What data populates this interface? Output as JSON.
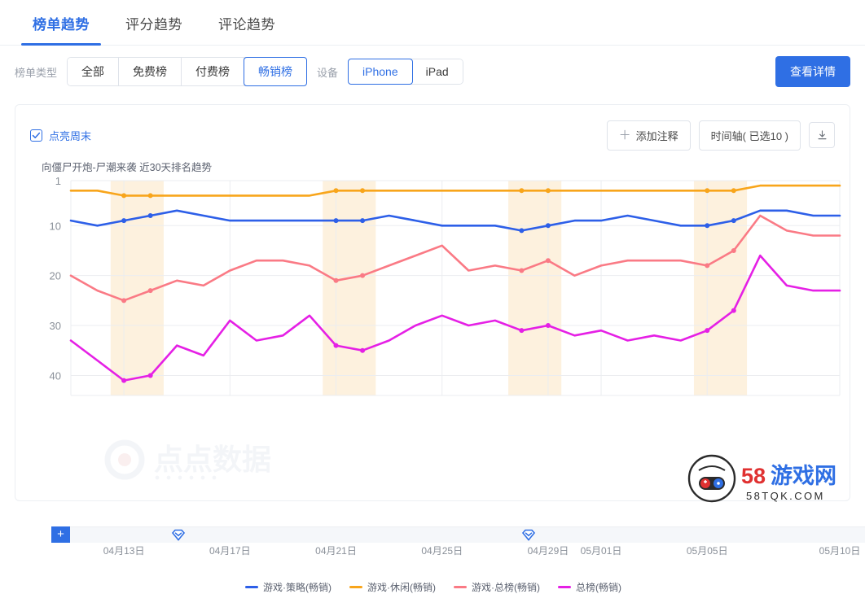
{
  "tabs": [
    {
      "label": "榜单趋势",
      "active": true
    },
    {
      "label": "评分趋势",
      "active": false
    },
    {
      "label": "评论趋势",
      "active": false
    }
  ],
  "filters": {
    "rank_type_label": "榜单类型",
    "rank_type_options": [
      "全部",
      "免费榜",
      "付费榜",
      "畅销榜"
    ],
    "rank_type_selected": "畅销榜",
    "device_label": "设备",
    "device_options": [
      "iPhone",
      "iPad"
    ],
    "device_selected": "iPhone",
    "detail_button": "查看详情"
  },
  "card": {
    "weekend_checkbox_label": "点亮周末",
    "weekend_checked": true,
    "add_note_button": "添加注释",
    "add_note_plus": "＋",
    "timeline_button": "时间轴( 已选10 )",
    "download_icon": "download-icon",
    "plus_marker": "+",
    "timeline_markers": [
      200,
      630
    ]
  },
  "watermark": {
    "center_text": "点点数据",
    "corner_brand": "58 游戏网",
    "corner_domain": "58TQK.COM"
  },
  "colors": {
    "accent": "#2f6fe4",
    "strategy": "#2d5fe8",
    "casual": "#f8a51b",
    "game_overall": "#fa7a85",
    "overall": "#e520e5",
    "weekend_band": "#fdf1de",
    "grid": "#ebedf0"
  },
  "chart_data": {
    "type": "line",
    "title": "向僵尸开炮-尸潮来袭 近30天排名趋势",
    "xlabel": "",
    "ylabel": "",
    "ylim": [
      1,
      44
    ],
    "y_inverted": true,
    "y_ticks": [
      1,
      10,
      20,
      30,
      40
    ],
    "grid": true,
    "legend_position": "bottom",
    "x": [
      "04月11日",
      "04月12日",
      "04月13日",
      "04月14日",
      "04月15日",
      "04月16日",
      "04月17日",
      "04月18日",
      "04月19日",
      "04月20日",
      "04月21日",
      "04月22日",
      "04月23日",
      "04月24日",
      "04月25日",
      "04月26日",
      "04月27日",
      "04月28日",
      "04月29日",
      "04月30日",
      "05月01日",
      "05月02日",
      "05月03日",
      "05月04日",
      "05月05日",
      "05月06日",
      "05月07日",
      "05月08日",
      "05月09日",
      "05月10日"
    ],
    "x_tick_labels": [
      "04月13日",
      "04月17日",
      "04月21日",
      "04月25日",
      "04月29日",
      "05月01日",
      "05月05日",
      "05月10日"
    ],
    "x_tick_indices": [
      2,
      6,
      10,
      14,
      18,
      20,
      24,
      29
    ],
    "weekend_bands": [
      [
        2,
        3
      ],
      [
        10,
        11
      ],
      [
        17,
        18
      ],
      [
        24,
        25
      ]
    ],
    "series": [
      {
        "name": "游戏·策略(畅销)",
        "color": "#2d5fe8",
        "values": [
          9,
          10,
          9,
          8,
          7,
          8,
          9,
          9,
          9,
          9,
          9,
          9,
          8,
          9,
          10,
          10,
          10,
          11,
          10,
          9,
          9,
          8,
          9,
          10,
          10,
          9,
          7,
          7,
          8,
          8
        ]
      },
      {
        "name": "游戏·休闲(畅销)",
        "color": "#f8a51b",
        "values": [
          3,
          3,
          4,
          4,
          4,
          4,
          4,
          4,
          4,
          4,
          3,
          3,
          3,
          3,
          3,
          3,
          3,
          3,
          3,
          3,
          3,
          3,
          3,
          3,
          3,
          3,
          2,
          2,
          2,
          2
        ]
      },
      {
        "name": "游戏·总榜(畅销)",
        "color": "#fa7a85",
        "values": [
          20,
          23,
          25,
          23,
          21,
          22,
          19,
          17,
          17,
          18,
          21,
          20,
          18,
          16,
          14,
          19,
          18,
          19,
          17,
          20,
          18,
          17,
          17,
          17,
          18,
          15,
          8,
          11,
          12,
          12
        ]
      },
      {
        "name": "总榜(畅销)",
        "color": "#e520e5",
        "values": [
          33,
          37,
          41,
          40,
          34,
          36,
          29,
          33,
          32,
          28,
          34,
          35,
          33,
          30,
          28,
          30,
          29,
          31,
          30,
          32,
          31,
          33,
          32,
          33,
          31,
          27,
          16,
          22,
          23,
          23
        ]
      }
    ]
  }
}
